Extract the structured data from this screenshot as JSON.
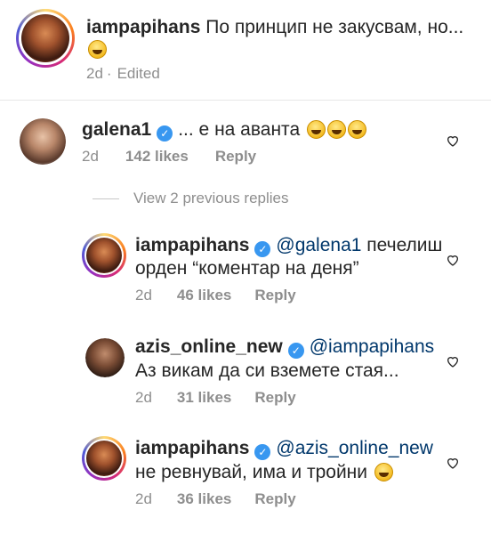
{
  "post": {
    "username": "iampapihans",
    "text": "По принцип не закусвам, но...",
    "time": "2d",
    "edited": "Edited"
  },
  "comment": {
    "username": "galena1",
    "text": "... е на аванта",
    "time": "2d",
    "likes": "142 likes",
    "reply": "Reply"
  },
  "view_replies": "View 2 previous replies",
  "replies": [
    {
      "username": "iampapihans",
      "mention": "@galena1",
      "text1": "печелиш",
      "text2": "орден “коментар на деня”",
      "time": "2d",
      "likes": "46 likes",
      "reply": "Reply"
    },
    {
      "username": "azis_online_new",
      "mention": "@iampapihans",
      "text1": "",
      "text2": "Аз викам да си вземете стая...",
      "time": "2d",
      "likes": "31 likes",
      "reply": "Reply"
    },
    {
      "username": "iampapihans",
      "mention": "@azis_online_new",
      "text1": "",
      "text2": "не ревнувай, има и тройни",
      "time": "2d",
      "likes": "36 likes",
      "reply": "Reply"
    }
  ]
}
